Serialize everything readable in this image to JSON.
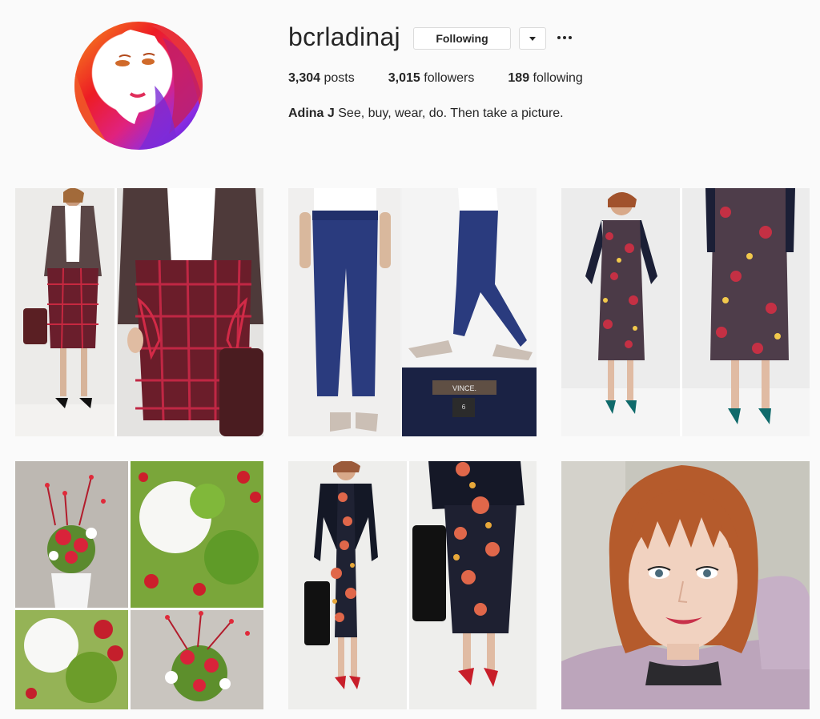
{
  "profile": {
    "username": "bcrladinaj",
    "follow_label": "Following",
    "dropdown_icon": "chevron-down-icon",
    "more_icon": "more-options-icon",
    "posts_count": "3,304",
    "posts_label": "posts",
    "followers_count": "3,015",
    "followers_label": "followers",
    "following_count": "189",
    "following_label": "following",
    "full_name": "Adina J",
    "bio": "See, buy, wear, do. Then take a picture."
  },
  "posts": [
    {
      "subject": "plaid pencil skirt with brown blazer"
    },
    {
      "subject": "navy cargo pants with snakeskin sneakers",
      "tag_brand": "VINCE.",
      "tag_size": "6"
    },
    {
      "subject": "floral print dress with navy turtleneck"
    },
    {
      "subject": "red and white flower arrangement"
    },
    {
      "subject": "navy floral dress with black blazer"
    },
    {
      "subject": "selfie with auburn bob"
    }
  ]
}
